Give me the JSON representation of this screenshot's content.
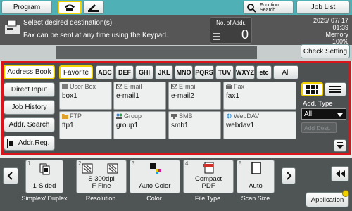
{
  "topbar": {
    "program_label": "Program",
    "function_search_label": "Function\nSearch",
    "job_list_label": "Job List"
  },
  "message": {
    "line1": "Select desired destination(s).",
    "line2": "Fax can be sent at any time using the Keypad.",
    "addr_count_label": "No. of Addr.",
    "addr_count_value": "0",
    "date": "2025/ 07/ 17",
    "time": "01:39",
    "memory_label": "Memory",
    "memory_value": "100%",
    "check_setting_label": "Check Setting"
  },
  "sidebar": {
    "items": [
      {
        "label": "Address Book"
      },
      {
        "label": "Direct Input"
      },
      {
        "label": "Job History"
      },
      {
        "label": "Addr. Search"
      },
      {
        "label": "Addr.Reg."
      }
    ]
  },
  "index_tabs": {
    "favorite": "Favorite",
    "letters": [
      "ABC",
      "DEF",
      "GHI",
      "JKL",
      "MNO",
      "PQRS",
      "TUV",
      "WXYZ",
      "etc"
    ],
    "all": "All"
  },
  "addresses": [
    {
      "type": "User Box",
      "name": "box1"
    },
    {
      "type": "E-mail",
      "name": "e-mail1"
    },
    {
      "type": "E-mail",
      "name": "e-mail2"
    },
    {
      "type": "Fax",
      "name": "fax1"
    },
    {
      "type": "FTP",
      "name": "ftp1"
    },
    {
      "type": "Group",
      "name": "group1"
    },
    {
      "type": "SMB",
      "name": "smb1"
    },
    {
      "type": "WebDAV",
      "name": "webdav1"
    }
  ],
  "right_panel": {
    "add_type_label": "Add. Type",
    "add_type_value": "All",
    "add_dest_placeholder": "Add Dest."
  },
  "settings": [
    {
      "num": "1",
      "value": "1-Sided",
      "caption": "Simplex/\nDuplex"
    },
    {
      "num": "2",
      "value": "S 300dpi\nF Fine",
      "caption": "Resolution"
    },
    {
      "num": "3",
      "value": "Auto Color",
      "caption": "Color"
    },
    {
      "num": "4",
      "value": "Compact\nPDF",
      "caption": "File Type"
    },
    {
      "num": "5",
      "value": "Auto",
      "caption": "Scan Size"
    }
  ],
  "application_label": "Application",
  "colors": {
    "accent_teal": "#4fb0b6",
    "highlight_yellow": "#f2d100",
    "selection_red": "#d9141b"
  }
}
